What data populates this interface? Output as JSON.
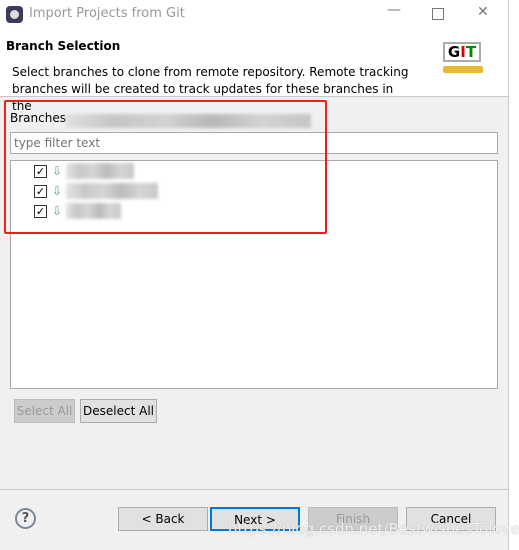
{
  "window": {
    "title": "Import Projects from Git",
    "minimize_icon": "minimize-icon",
    "maximize_icon": "maximize-icon",
    "close_icon": "close-icon"
  },
  "header": {
    "title": "Branch Selection",
    "description": "Select branches to clone from remote repository. Remote tracking branches will be created to track updates for these branches in the",
    "logo_text": "GIT"
  },
  "branches": {
    "label": "Branches",
    "filter_placeholder": "type filter text",
    "items": [
      {
        "checked": true
      },
      {
        "checked": true
      },
      {
        "checked": true
      }
    ]
  },
  "buttons": {
    "select_all": "Select All",
    "deselect_all": "Deselect All",
    "back": "< Back",
    "next": "Next >",
    "finish": "Finish",
    "cancel": "Cancel",
    "help": "?"
  },
  "watermark": "https://blog.csdn.net/BestwishesTolover",
  "colors": {
    "highlight_box": "#f21c1c",
    "default_button_border": "#0078d7"
  }
}
